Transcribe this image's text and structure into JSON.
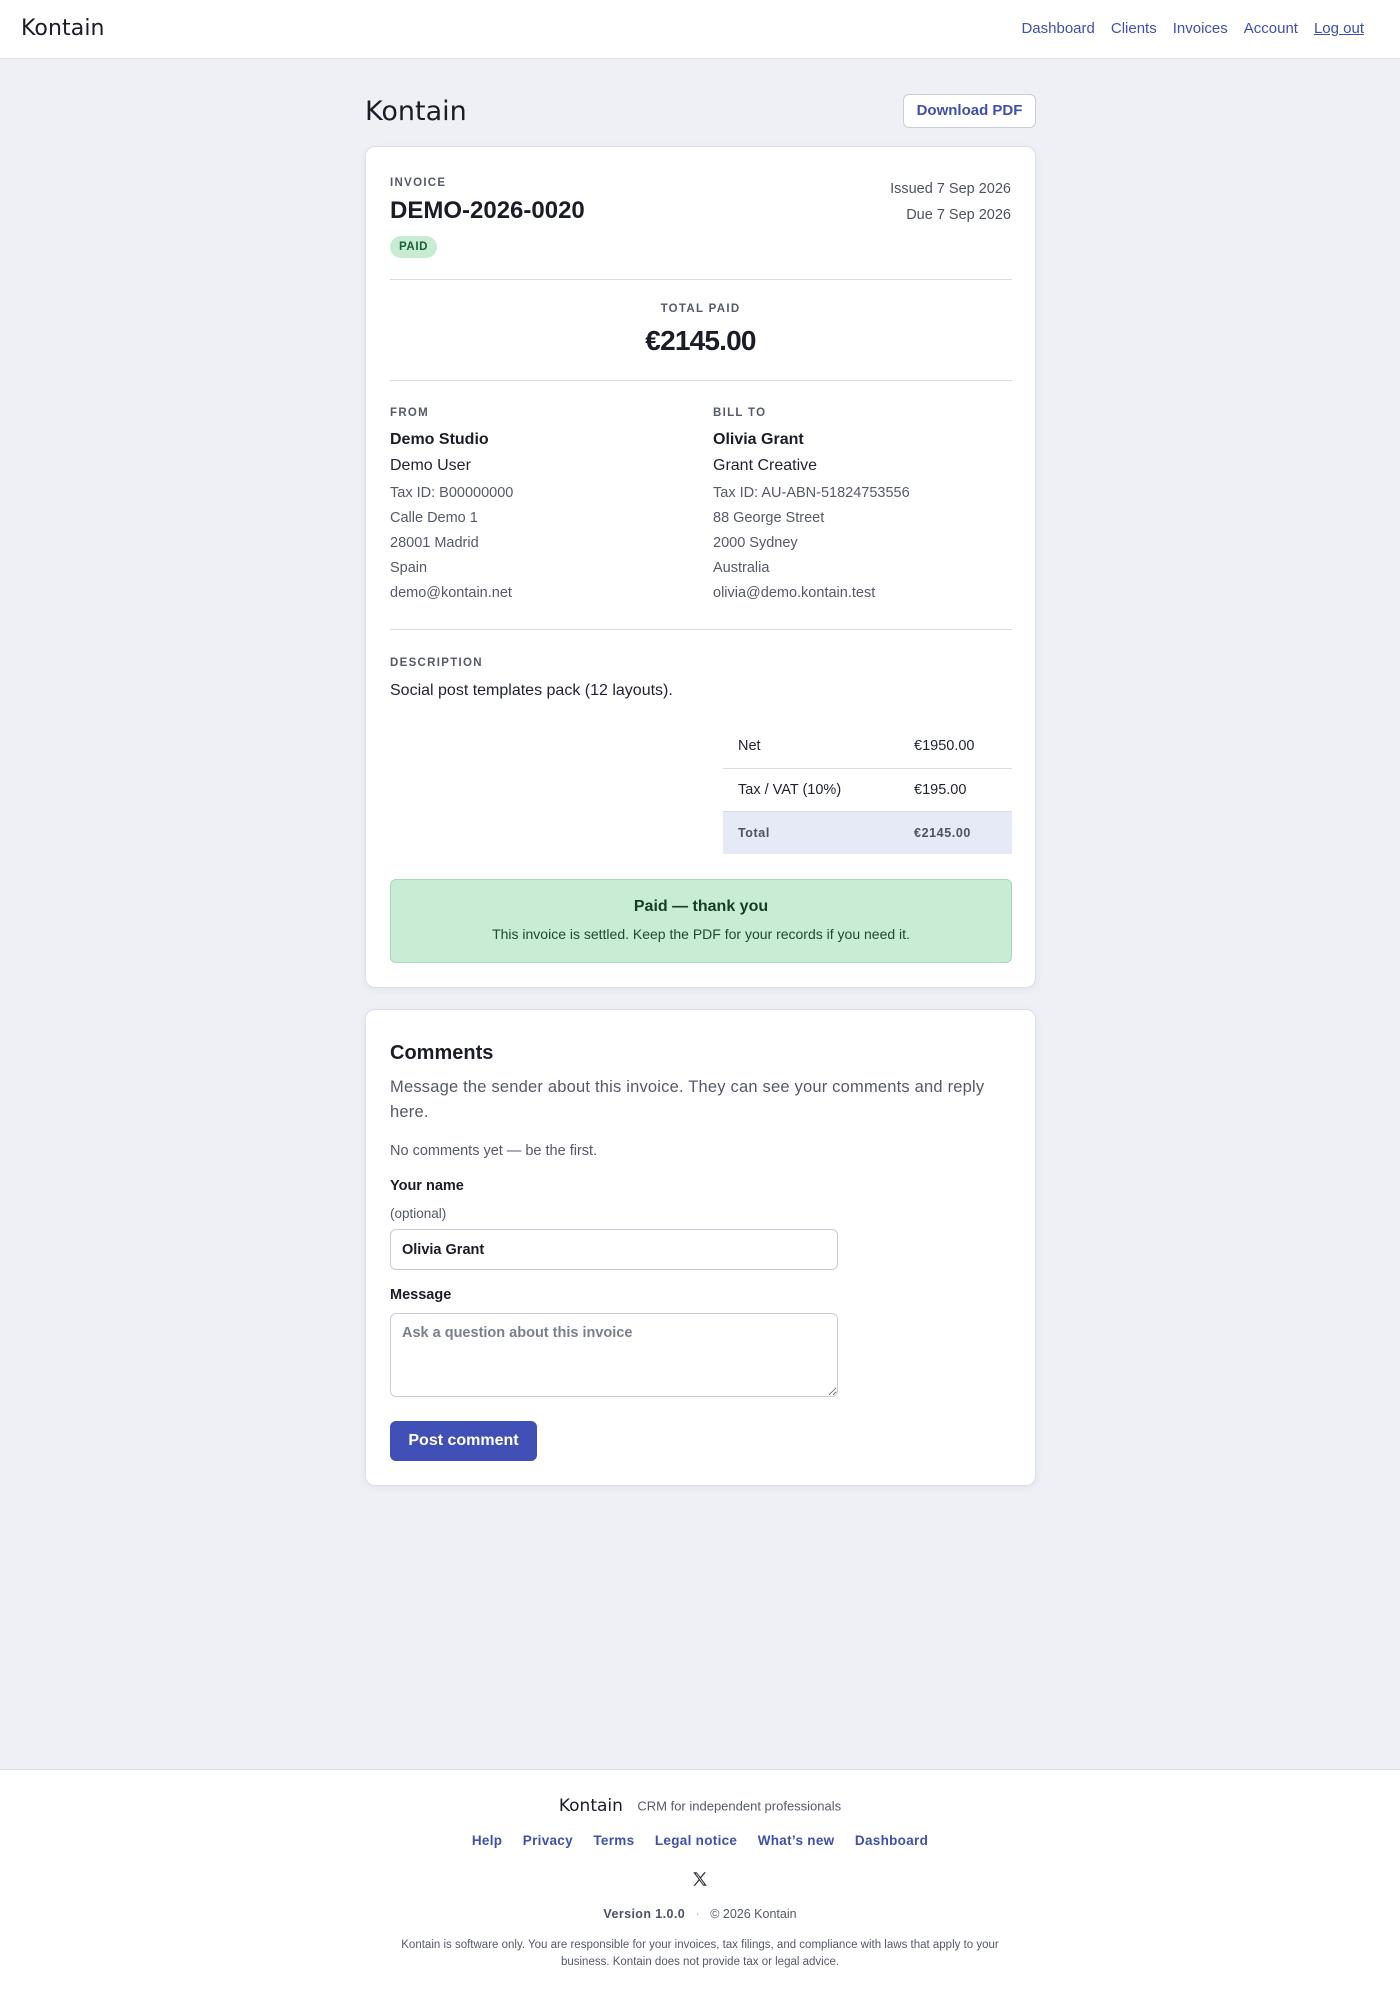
{
  "nav": {
    "brand": "Kontain",
    "links": [
      "Dashboard",
      "Clients",
      "Invoices",
      "Account"
    ],
    "logout": "Log out"
  },
  "header": {
    "title": "Kontain",
    "download_pdf": "Download PDF"
  },
  "invoice": {
    "label": "INVOICE",
    "number": "DEMO-2026-0020",
    "status": "PAID",
    "issued": "Issued 7 Sep 2026",
    "due": "Due 7 Sep 2026",
    "total_label": "TOTAL PAID",
    "total_value": "€2145.00",
    "from": {
      "label": "FROM",
      "name": "Demo Studio",
      "contact": "Demo User",
      "tax_id": "Tax ID: B00000000",
      "street": "Calle Demo 1",
      "city": "28001 Madrid",
      "country": "Spain",
      "email": "demo@kontain.net"
    },
    "bill_to": {
      "label": "BILL TO",
      "name": "Olivia Grant",
      "company": "Grant Creative",
      "tax_id": "Tax ID: AU-ABN-51824753556",
      "street": "88 George Street",
      "city": "2000 Sydney",
      "country": "Australia",
      "email": "olivia@demo.kontain.test"
    },
    "description_label": "DESCRIPTION",
    "description": "Social post templates pack (12 layouts).",
    "totals": {
      "net_label": "Net",
      "net_value": "€1950.00",
      "tax_label": "Tax / VAT (10%)",
      "tax_value": "€195.00",
      "total_label": "Total",
      "total_value": "€2145.00"
    },
    "paid_box": {
      "title": "Paid — thank you",
      "text": "This invoice is settled. Keep the PDF for your records if you need it."
    }
  },
  "comments": {
    "title": "Comments",
    "subtitle": "Message the sender about this invoice. They can see your comments and reply here.",
    "empty": "No comments yet — be the first.",
    "name_label": "Your name",
    "name_optional": "(optional)",
    "name_value": "Olivia Grant",
    "message_label": "Message",
    "message_placeholder": "Ask a question about this invoice",
    "post_button": "Post comment"
  },
  "footer": {
    "brand": "Kontain",
    "tagline": "CRM for independent professionals",
    "links": [
      "Help",
      "Privacy",
      "Terms",
      "Legal notice",
      "What’s new",
      "Dashboard"
    ],
    "version": "Version 1.0.0",
    "separator": "·",
    "copyright": "© 2026 Kontain",
    "disclaimer": "Kontain is software only. You are responsible for your invoices, tax filings, and compliance with laws that apply to your business. Kontain does not provide tax or legal advice."
  }
}
